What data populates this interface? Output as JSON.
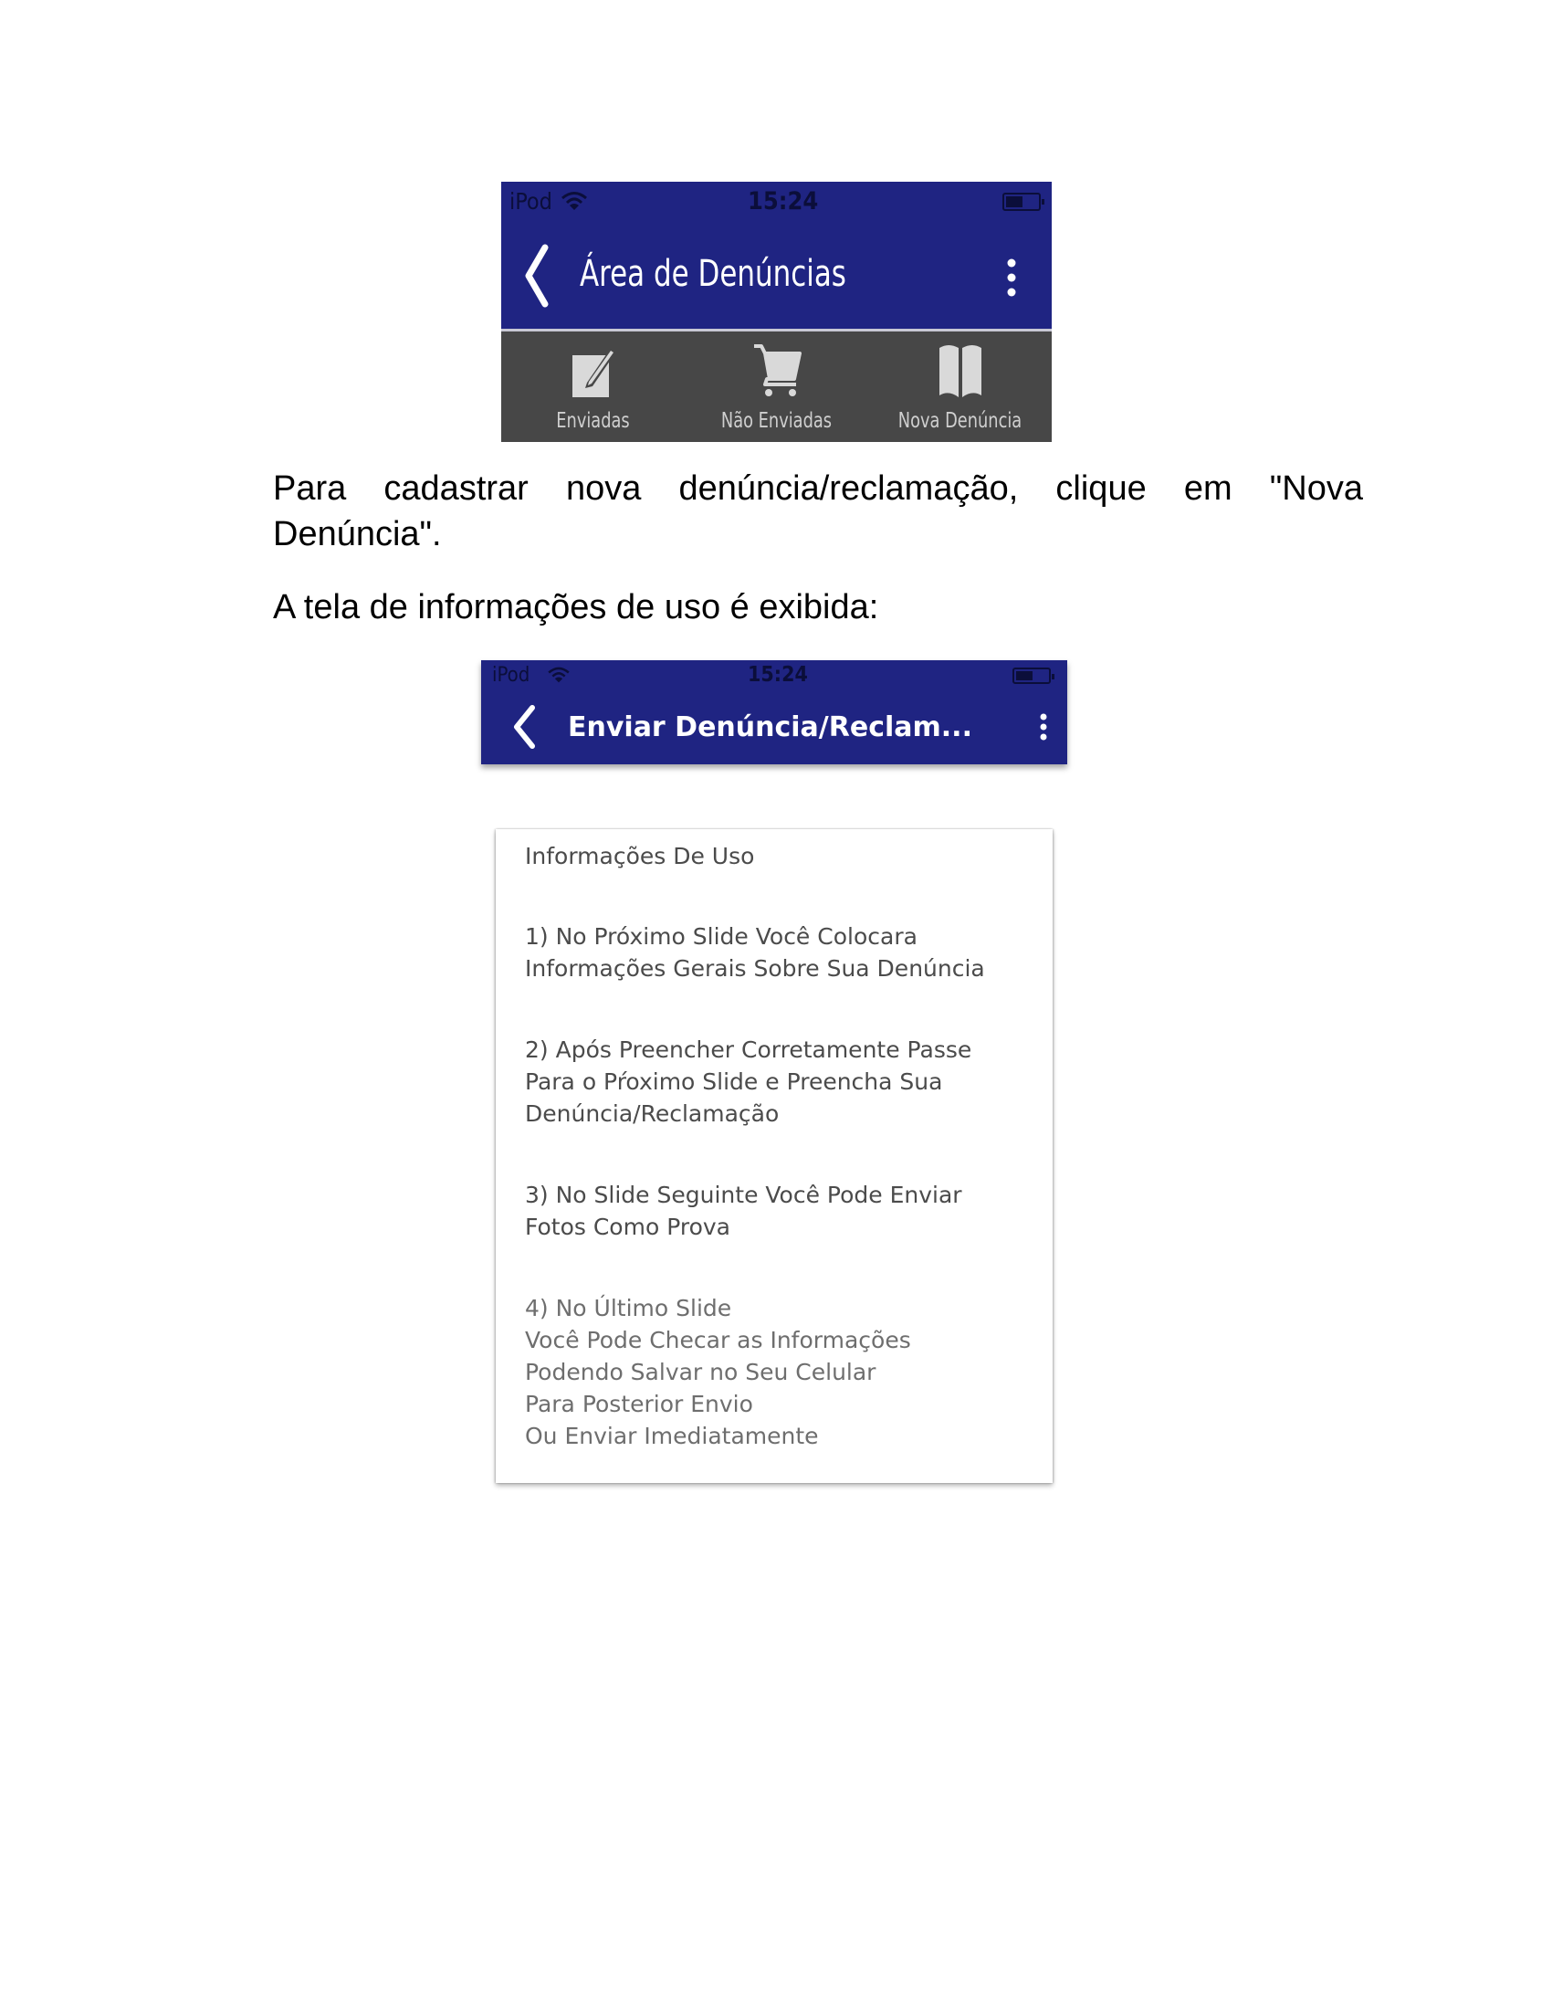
{
  "screenshot1": {
    "status_bar": {
      "carrier": "iPod",
      "time": "15:24"
    },
    "nav": {
      "title": "Área de Denúncias"
    },
    "tabs": [
      {
        "label": "Enviadas",
        "icon": "edit-icon"
      },
      {
        "label": "Não Enviadas",
        "icon": "cart-icon"
      },
      {
        "label": "Nova Denúncia",
        "icon": "book-icon"
      }
    ],
    "colors": {
      "nav_bg": "#1f2482",
      "tab_bg": "#474747",
      "tab_text": "#cfcfcf"
    }
  },
  "paragraphs": [
    "Para cadastrar nova denúncia/reclamação, clique em \"Nova Denúncia\".",
    "A tela de informações de uso é exibida:"
  ],
  "screenshot2": {
    "status_bar": {
      "carrier": "iPod",
      "time": "15:24"
    },
    "nav": {
      "title": "Enviar Denúncia/Reclam..."
    },
    "card": {
      "heading": "Informações De Uso",
      "item1": [
        "1) No Próximo Slide Você Colocara",
        "Informações Gerais Sobre Sua Denúncia"
      ],
      "item2": [
        "2) Após Preencher Corretamente Passe",
        "Para o Pŕoximo Slide e Preencha Sua",
        "Denúncia/Reclamação"
      ],
      "item3": [
        "3) No Slide Seguinte Você Pode Enviar",
        "Fotos Como Prova"
      ],
      "item4": [
        "4) No Último Slide",
        "Você Pode Checar as Informações",
        "Podendo Salvar no Seu Celular",
        "Para Posterior Envio",
        "Ou Enviar Imediatamente"
      ]
    }
  }
}
